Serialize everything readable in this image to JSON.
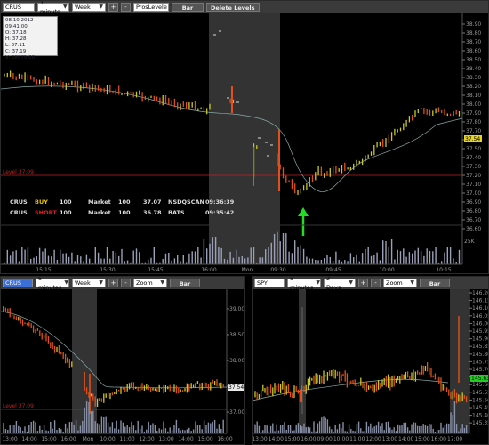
{
  "top": {
    "symbol": "CRUS",
    "interval": "1 minute",
    "range": "Week",
    "plus": "+",
    "minus": "-",
    "style": "ProsLevele",
    "type_button": "Bar",
    "delete_button": "Delete Levels",
    "info": {
      "datetime": "08.10.2012 09:41:00",
      "open": "O: 37.18",
      "high": "H: 37.28",
      "low": "L: 37.11",
      "close": "C: 37.19",
      "volume": "V: 28075.00"
    },
    "level_label": "Level 37.09",
    "current_price": "37.54",
    "y_ticks": [
      "38.90",
      "38.80",
      "38.70",
      "38.60",
      "38.50",
      "38.40",
      "38.30",
      "38.20",
      "38.10",
      "38.00",
      "37.90",
      "37.80",
      "37.70",
      "37.60",
      "37.50",
      "37.40",
      "37.30",
      "37.20",
      "37.10",
      "37.00",
      "36.90",
      "36.80",
      "36.70",
      "36.60"
    ],
    "vol_tick": "25K",
    "x_ticks": [
      "15:15",
      "15:30",
      "15:45",
      "16:00",
      "Mon",
      "09:30",
      "09:45",
      "10:00",
      "10:15"
    ],
    "trades": [
      {
        "sym": "CRUS",
        "side": "BUY",
        "qty": "100",
        "kind": "Market",
        "qty2": "100",
        "price": "37.07",
        "venue": "NSDQSCAN",
        "time": "09:36:39"
      },
      {
        "sym": "CRUS",
        "side": "SHORT",
        "qty": "100",
        "kind": "Market",
        "qty2": "100",
        "price": "36.78",
        "venue": "BATS",
        "time": "09:35:42"
      }
    ]
  },
  "left": {
    "symbol": "CRUS",
    "interval": "5 minutes",
    "range": "Week",
    "plus": "+",
    "minus": "-",
    "zoom": "Zoom",
    "type_button": "Bar",
    "level_label": "Level 37.09",
    "current_price": "37.54",
    "y_ticks": [
      "39.00",
      "38.50",
      "38.00",
      "37.50",
      "37.00"
    ],
    "x_ticks": [
      "13:00",
      "14:00",
      "15:00",
      "16:00",
      "Mon",
      "10:00",
      "11:00",
      "12:00",
      "13:00",
      "14:00",
      "15:00",
      "16:00"
    ]
  },
  "right": {
    "symbol": "SPY",
    "interval": "5 minutes",
    "range": "2 Days",
    "plus": "+",
    "minus": "-",
    "zoom": "Zoom",
    "type_button": "Bar",
    "current_price": "145.63",
    "y_ticks": [
      "146.20",
      "146.15",
      "146.10",
      "146.05",
      "146.00",
      "145.95",
      "145.90",
      "145.85",
      "145.80",
      "145.75",
      "145.70",
      "145.65",
      "145.60",
      "145.55",
      "145.50",
      "145.45",
      "145.40",
      "145.35"
    ],
    "x_ticks": [
      "13:00",
      "14:00",
      "15:00",
      "16:00",
      "09:00",
      "10:00",
      "11:00",
      "12:00",
      "13:00",
      "14:00",
      "15:00",
      "16:00",
      "17:00"
    ]
  },
  "colors": {
    "up": "#c8c82a",
    "down": "#e2501a",
    "level": "#c02020",
    "highlight": "#333333",
    "arrow": "#22dd22"
  }
}
